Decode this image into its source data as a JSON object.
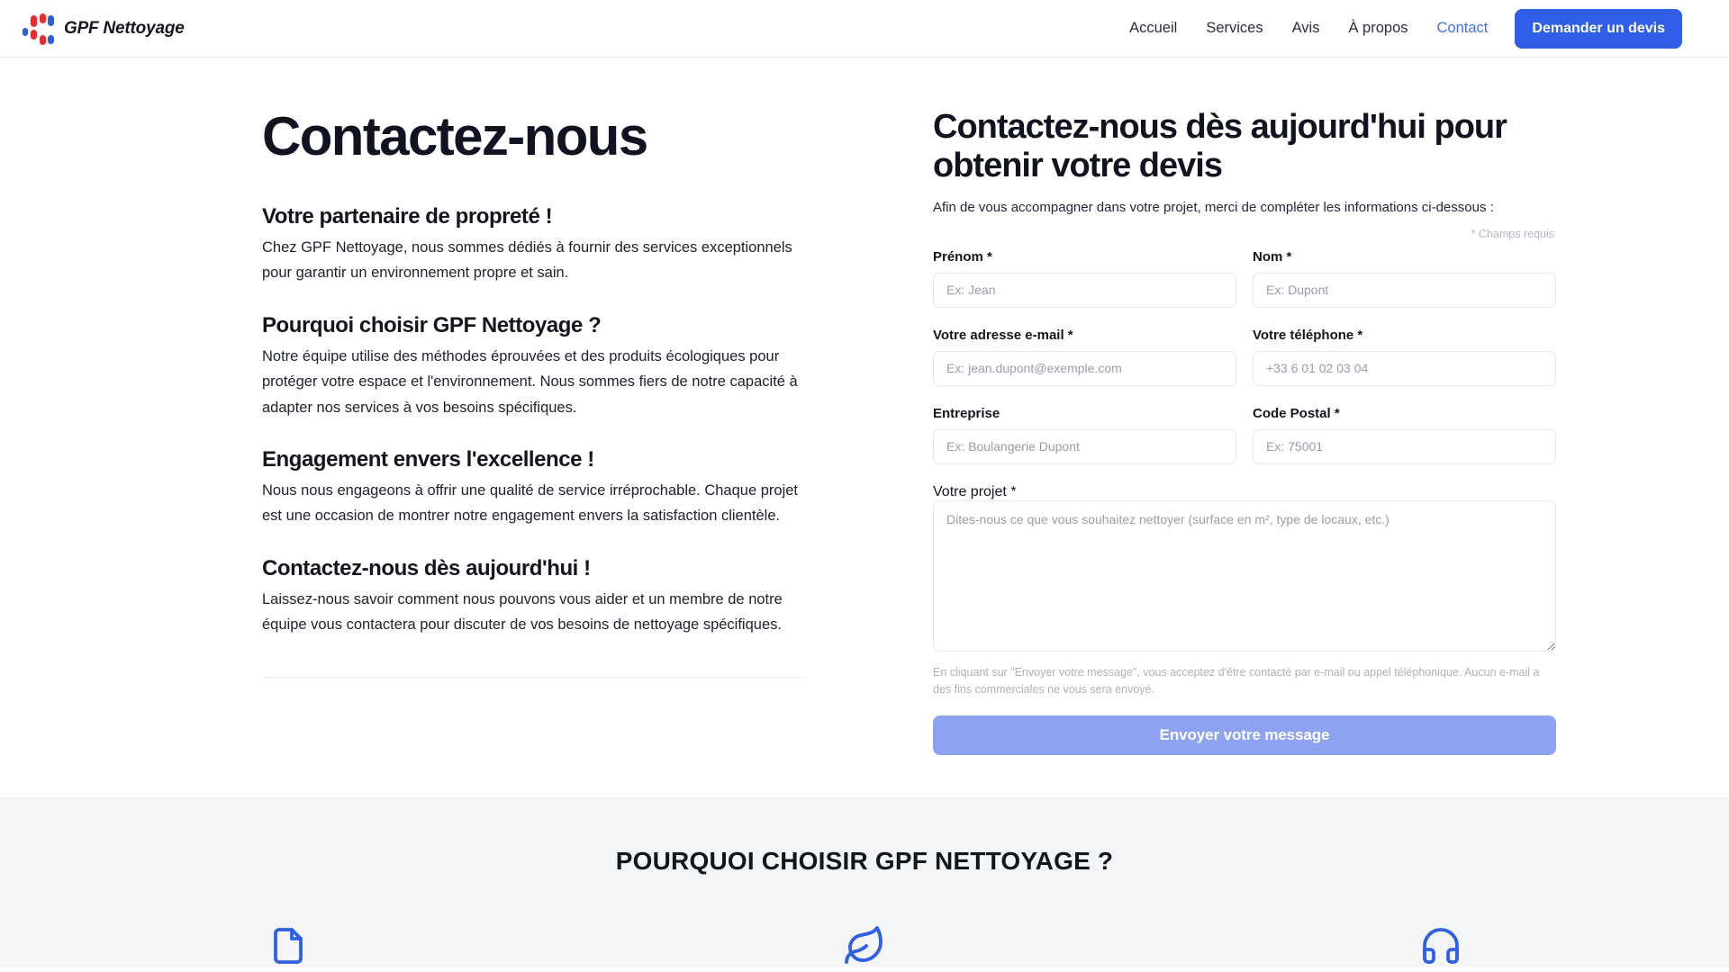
{
  "header": {
    "brand_name": "GPF Nettoyage",
    "nav": [
      {
        "label": "Accueil",
        "active": false
      },
      {
        "label": "Services",
        "active": false
      },
      {
        "label": "Avis",
        "active": false
      },
      {
        "label": "À propos",
        "active": false
      },
      {
        "label": "Contact",
        "active": true
      }
    ],
    "cta_label": "Demander un devis",
    "accent_color": "#2f5fe8",
    "active_link_color": "#3f6df0"
  },
  "left": {
    "page_title": "Contactez-nous",
    "blocks": [
      {
        "heading": "Votre partenaire de propreté !",
        "body": "Chez GPF Nettoyage, nous sommes dédiés à fournir des services exceptionnels pour garantir un environnement propre et sain."
      },
      {
        "heading": "Pourquoi choisir GPF Nettoyage ?",
        "body": "Notre équipe utilise des méthodes éprouvées et des produits écologiques pour protéger votre espace et l'environnement. Nous sommes fiers de notre capacité à adapter nos services à vos besoins spécifiques."
      },
      {
        "heading": "Engagement envers l'excellence !",
        "body": "Nous nous engageons à offrir une qualité de service irréprochable. Chaque projet est une occasion de montrer notre engagement envers la satisfaction clientèle."
      },
      {
        "heading": "Contactez-nous dès aujourd'hui !",
        "body": "Laissez-nous savoir comment nous pouvons vous aider et un membre de notre équipe vous contactera pour discuter de vos besoins de nettoyage spécifiques."
      }
    ]
  },
  "form": {
    "title": "Contactez-nous dès aujourd'hui pour obtenir votre devis",
    "subtitle": "Afin de vous accompagner dans votre projet, merci de compléter les informations ci-dessous :",
    "required_note": "* Champs requis",
    "fields": {
      "prenom": {
        "label": "Prénom *",
        "placeholder": "Ex: Jean",
        "value": ""
      },
      "nom": {
        "label": "Nom *",
        "placeholder": "Ex: Dupont",
        "value": ""
      },
      "email": {
        "label": "Votre adresse e-mail *",
        "placeholder": "Ex: jean.dupont@exemple.com",
        "value": ""
      },
      "telephone": {
        "label": "Votre téléphone *",
        "placeholder": "+33 6 01 02 03 04",
        "value": ""
      },
      "entreprise": {
        "label": "Entreprise",
        "placeholder": "Ex: Boulangerie Dupont",
        "value": ""
      },
      "code_postal": {
        "label": "Code Postal *",
        "placeholder": "Ex: 75001",
        "value": ""
      },
      "projet": {
        "label": "Votre projet *",
        "placeholder": "Dites-nous ce que vous souhaitez nettoyer (surface en m², type de locaux, etc.)",
        "value": ""
      }
    },
    "legal": "En cliquant sur \"Envoyer votre message\", vous acceptez d'être contacté par e-mail ou appel téléphonique. Aucun e-mail a des fins commerciales ne vous sera envoyé.",
    "submit_label": "Envoyer votre message",
    "submit_color": "#8da3f2"
  },
  "why_section": {
    "title": "POURQUOI CHOISIR GPF NETTOYAGE ?",
    "background": "#f4f5f7",
    "icon_color": "#2f5fe8",
    "icons": [
      {
        "name": "document-icon"
      },
      {
        "name": "leaf-icon"
      },
      {
        "name": "headset-icon"
      }
    ]
  }
}
